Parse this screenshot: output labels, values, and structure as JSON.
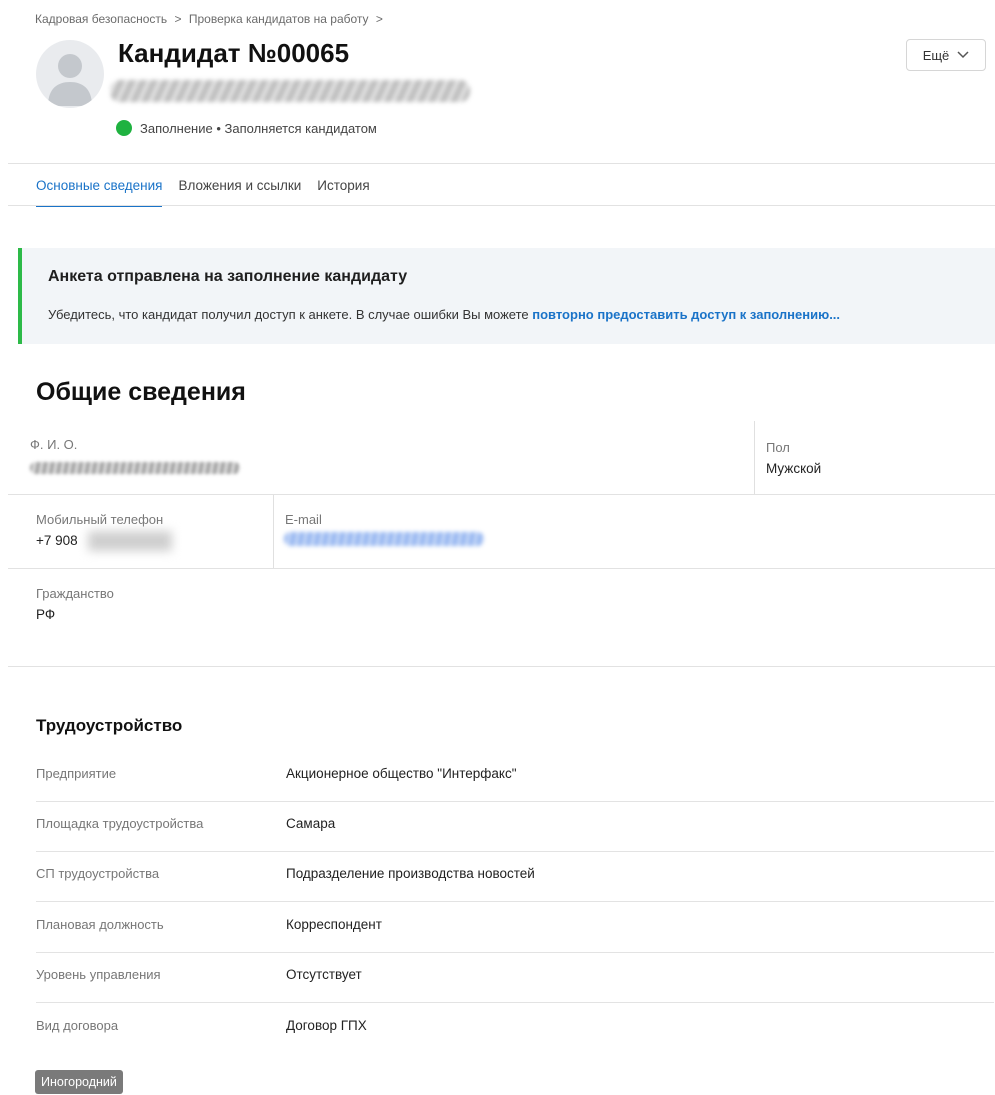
{
  "breadcrumb": {
    "items": [
      "Кадровая безопасность",
      ">",
      "Проверка кандидатов на работу",
      ">"
    ]
  },
  "candidate": {
    "title": "Кандидат №00065",
    "status": "Заполнение • Заполняется кандидатом"
  },
  "header": {
    "more_label": "Ещё"
  },
  "tabs": [
    {
      "label": "Основные сведения",
      "active": true
    },
    {
      "label": "Вложения и ссылки",
      "active": false
    },
    {
      "label": "История",
      "active": false
    }
  ],
  "notice": {
    "title": "Анкета отправлена на заполнение кандидату",
    "text": "Убедитесь, что кандидат получил доступ к анкете. В случае ошибки Вы можете ",
    "link": "повторно предоставить доступ к заполнению..."
  },
  "general": {
    "title": "Общие сведения",
    "fio_label": "Ф. И. О.",
    "gender_label": "Пол",
    "gender_value": "Мужской",
    "phone_label": "Мобильный телефон",
    "phone_value": "+7 908",
    "email_label": "E-mail",
    "citizenship_label": "Гражданство",
    "citizenship_value": "РФ"
  },
  "employment": {
    "title": "Трудоустройство",
    "rows": [
      {
        "label": "Предприятие",
        "value": "Акционерное общество \"Интерфакс\""
      },
      {
        "label": "Площадка трудоустройства",
        "value": "Самара"
      },
      {
        "label": "СП трудоустройства",
        "value": "Подразделение производства новостей"
      },
      {
        "label": "Плановая должность",
        "value": "Корреспондент"
      },
      {
        "label": "Уровень управления",
        "value": "Отсутствует"
      },
      {
        "label": "Вид договора",
        "value": "Договор ГПХ"
      }
    ],
    "tag": "Иногородний"
  },
  "colors": {
    "accent": "#1a73c8",
    "status_green": "#1fb240",
    "notice_border": "#2dba48",
    "notice_bg": "#f2f5f8",
    "tag_bg": "#7a7a7a"
  }
}
